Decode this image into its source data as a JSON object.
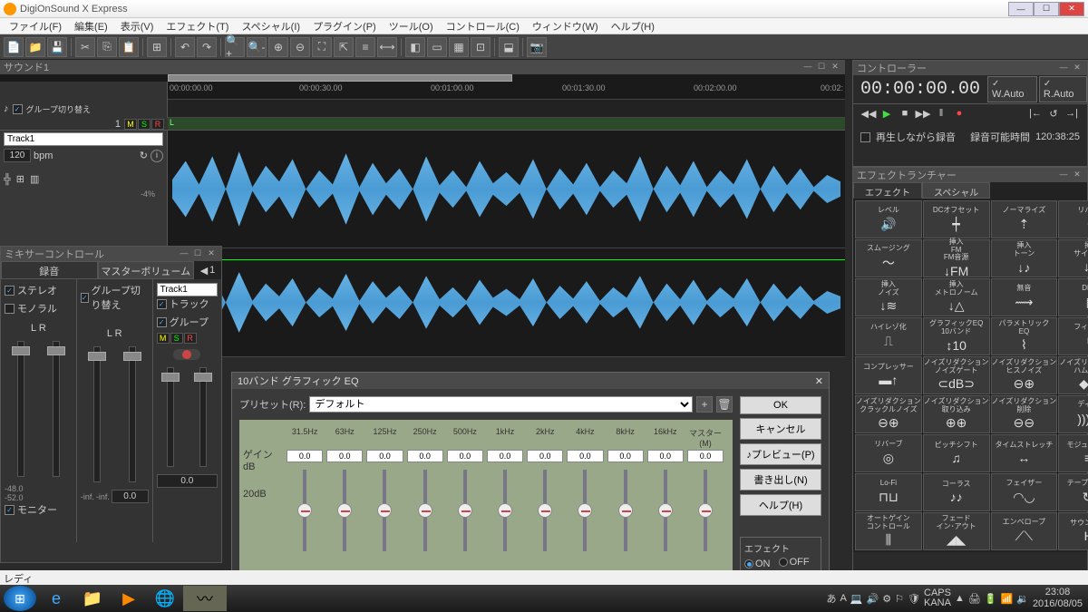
{
  "app": {
    "title": "DigiOnSound X Express"
  },
  "menu": [
    "ファイル(F)",
    "編集(E)",
    "表示(V)",
    "エフェクト(T)",
    "スペシャル(I)",
    "プラグイン(P)",
    "ツール(O)",
    "コントロール(C)",
    "ウィンドウ(W)",
    "ヘルプ(H)"
  ],
  "sound": {
    "title": "サウンド1",
    "timecodes": [
      "00:00:00.00",
      "00:00:30.00",
      "00:01:00.00",
      "00:01:30.00",
      "00:02:00.00",
      "00:02:"
    ],
    "group_switch": "グループ切り替え",
    "track_num": "1",
    "track_name": "Track1",
    "bpm_val": "120",
    "bpm_lbl": "bpm",
    "pct": "-4%"
  },
  "mixer": {
    "title": "ミキサーコントロール",
    "tab_rec": "録音",
    "tab_master": "マスターボリューム",
    "stereo": "ステレオ",
    "mono": "モノラル",
    "lr": "L   R",
    "group": "グループ切り替え",
    "track": "トラック",
    "grouplbl": "グループ",
    "track_name": "Track1",
    "inf": "-inf.",
    "val48": "-48.0",
    "val52": "-52.0",
    "zero": "0.0",
    "monitor": "モニター",
    "pan": "1"
  },
  "controller": {
    "title": "コントローラー",
    "time": "00:00:00.00",
    "wauto": "W.Auto",
    "rauto": "R.Auto",
    "recplay": "再生しながら録音",
    "rectime_lbl": "録音可能時間",
    "rectime": "120:38:25"
  },
  "launcher": {
    "title": "エフェクトランチャー",
    "tab_effect": "エフェクト",
    "tab_special": "スペシャル",
    "effects": [
      {
        "n": "レベル",
        "i": "🔊"
      },
      {
        "n": "DCオフセット",
        "i": "┿"
      },
      {
        "n": "ノーマライズ",
        "i": "⇡"
      },
      {
        "n": "リバース",
        "i": "↺"
      },
      {
        "n": "スムージング",
        "i": "〜"
      },
      {
        "n": "挿入\nFM\nFM音源",
        "i": "↓FM"
      },
      {
        "n": "挿入\nトーン",
        "i": "↓♪"
      },
      {
        "n": "挿入\nサイレンス",
        "i": "↓⊘"
      },
      {
        "n": "挿入\nノイズ",
        "i": "↓≋"
      },
      {
        "n": "挿入\nメトロノーム",
        "i": "↓△"
      },
      {
        "n": "無音",
        "i": "⟿"
      },
      {
        "n": "DHFX",
        "i": "▦"
      },
      {
        "n": "ハイレゾ化",
        "i": "⎍"
      },
      {
        "n": "グラフィックEQ\n10バンド",
        "i": "↕10"
      },
      {
        "n": "パラメトリック\nEQ",
        "i": "⌇"
      },
      {
        "n": "フィルター",
        "i": "⧉"
      },
      {
        "n": "コンプレッサー",
        "i": "▬↑"
      },
      {
        "n": "ノイズリダクション\nノイズゲート",
        "i": "⊂dB⊃"
      },
      {
        "n": "ノイズリダクション\nヒスノイズ",
        "i": "⊖⊕"
      },
      {
        "n": "ノイズリダクション\nハムノイズ",
        "i": "◆⚡"
      },
      {
        "n": "ノイズリダクション\nクラックルノイズ",
        "i": "⊖⊕"
      },
      {
        "n": "ノイズリダクション\n取り込み",
        "i": "⊕⊕"
      },
      {
        "n": "ノイズリダクション\n削除",
        "i": "⊖⊖"
      },
      {
        "n": "ディレイ",
        "i": "))) ･･"
      },
      {
        "n": "リバーブ",
        "i": "◎"
      },
      {
        "n": "ピッチシフト",
        "i": "♫"
      },
      {
        "n": "タイムストレッチ",
        "i": "↔"
      },
      {
        "n": "モジュレーター",
        "i": "≡≡"
      },
      {
        "n": "Lo-Fi",
        "i": "⊓⊔"
      },
      {
        "n": "コーラス",
        "i": "♪♪"
      },
      {
        "n": "フェイザー",
        "i": "◠◡"
      },
      {
        "n": "テープディレイ",
        "i": "↻))"
      },
      {
        "n": "オートゲイン\nコントロール",
        "i": "⫼"
      },
      {
        "n": "フェード\nイン･アウト",
        "i": "◢◣"
      },
      {
        "n": "エンベロープ",
        "i": "⟋⟍"
      },
      {
        "n": "サウンド形式",
        "i": "Hz"
      }
    ]
  },
  "eq": {
    "title": "10バンド グラフィック EQ",
    "preset_lbl": "プリセット(R):",
    "preset_val": "デフォルト",
    "gain_lbl": "ゲイン\ndB",
    "db20": "20dB",
    "master_lbl": "マスター(M)",
    "bands": [
      "31.5Hz",
      "63Hz",
      "125Hz",
      "250Hz",
      "500Hz",
      "1kHz",
      "2kHz",
      "4kHz",
      "8kHz",
      "16kHz"
    ],
    "values": [
      "0.0",
      "0.0",
      "0.0",
      "0.0",
      "0.0",
      "0.0",
      "0.0",
      "0.0",
      "0.0",
      "0.0"
    ],
    "master_val": "0.0",
    "ok": "OK",
    "cancel": "キャンセル",
    "preview": "♪プレビュー(P)",
    "export": "書き出し(N)",
    "help": "ヘルプ(H)",
    "effect_lbl": "エフェクト",
    "on": "ON",
    "off": "OFF"
  },
  "status": {
    "ready": "レディ"
  },
  "tray": {
    "caps": "CAPS",
    "kana": "KANA",
    "time": "23:08",
    "date": "2016/08/05"
  }
}
